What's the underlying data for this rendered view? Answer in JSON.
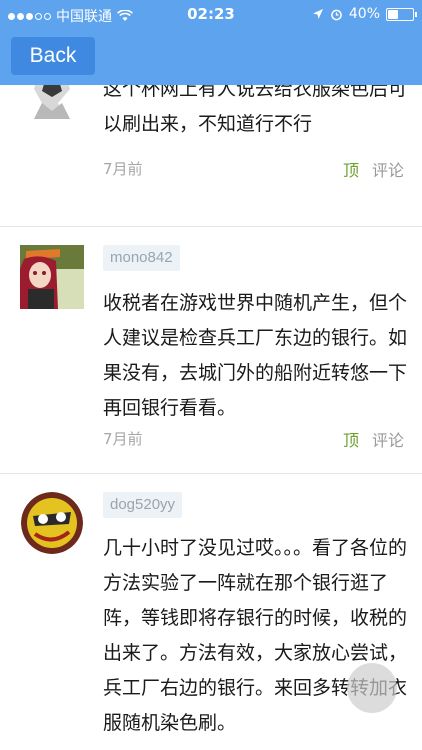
{
  "status_bar": {
    "carrier": "中国联通",
    "time": "02:23",
    "battery": "40%",
    "battery_level": 0.4
  },
  "nav": {
    "back_label": "Back"
  },
  "posts": [
    {
      "username": "",
      "text": "这个杯网上有人说去给衣服染色后可以刷出来，不知道行不行",
      "time": "7月前",
      "up_label": "顶",
      "comment_label": "评论"
    },
    {
      "username": "mono842",
      "text": "收税者在游戏世界中随机产生，但个人建议是检查兵工厂东边的银行。如果没有，去城门外的船附近转悠一下再回银行看看。",
      "time": "7月前",
      "up_label": "顶",
      "comment_label": "评论"
    },
    {
      "username": "dog520yy",
      "text": "几十小时了没见过哎。。。看了各位的方法实验了一阵就在那个银行逛了阵，等钱即将存银行的时候，收税的出来了。方法有效，大家放心尝试，兵工厂右边的银行。来回多转转加衣服随机染色刷。"
    }
  ]
}
